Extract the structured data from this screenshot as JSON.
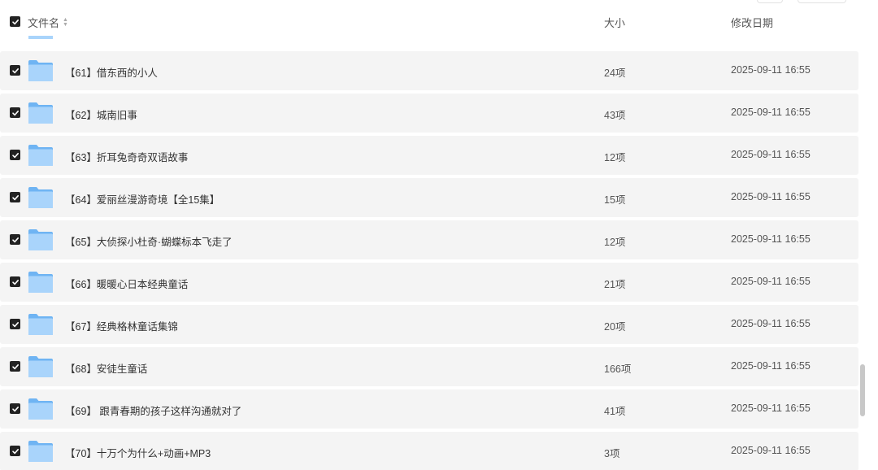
{
  "header": {
    "name_label": "文件名",
    "size_label": "大小",
    "date_label": "修改日期"
  },
  "rows": [
    {
      "name": "【61】借东西的小人",
      "size": "24项",
      "date": "2025-09-11 16:55"
    },
    {
      "name": "【62】城南旧事",
      "size": "43项",
      "date": "2025-09-11 16:55"
    },
    {
      "name": "【63】折耳兔奇奇双语故事",
      "size": "12项",
      "date": "2025-09-11 16:55"
    },
    {
      "name": "【64】爱丽丝漫游奇境【全15集】",
      "size": "15项",
      "date": "2025-09-11 16:55"
    },
    {
      "name": "【65】大侦探小杜奇·蝴蝶标本飞走了",
      "size": "12项",
      "date": "2025-09-11 16:55"
    },
    {
      "name": "【66】暖暖心日本经典童话",
      "size": "21项",
      "date": "2025-09-11 16:55"
    },
    {
      "name": "【67】经典格林童话集锦",
      "size": "20项",
      "date": "2025-09-11 16:55"
    },
    {
      "name": "【68】安徒生童话",
      "size": "166项",
      "date": "2025-09-11 16:55"
    },
    {
      "name": "【69】 跟青春期的孩子这样沟通就对了",
      "size": "41项",
      "date": "2025-09-11 16:55"
    },
    {
      "name": "【70】十万个为什么+动画+MP3",
      "size": "3项",
      "date": "2025-09-11 16:55"
    }
  ],
  "icons": {
    "checkbox": "checkbox-checked-icon",
    "folder": "folder-icon",
    "sort": "sort-icon"
  },
  "colors": {
    "row_bg": "#f4f4f4",
    "folder_light": "#a9d4fb",
    "folder_dark": "#6fb4f3",
    "checkbox": "#222222"
  }
}
